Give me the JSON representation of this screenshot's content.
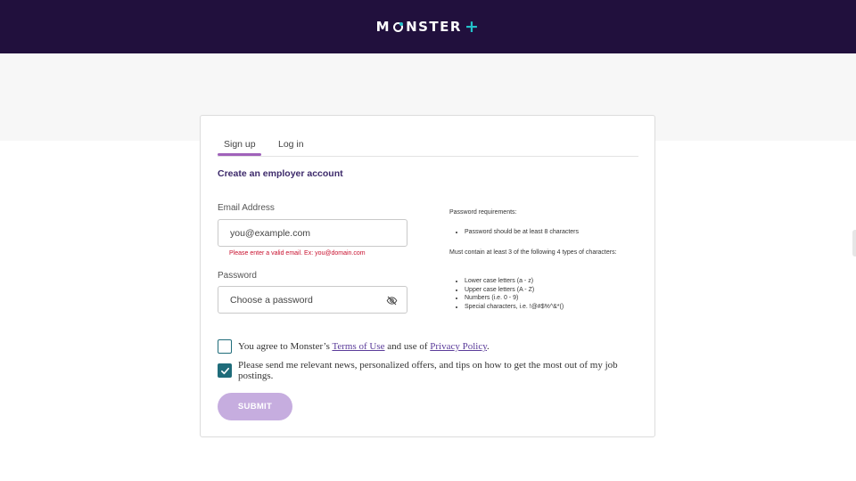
{
  "header": {
    "logo_text": "MONSTER",
    "logo_plus": "+",
    "logo_icon": "monster-logo-icon",
    "background_color": "#21103d",
    "accent_color": "#23c1c9"
  },
  "tabs": {
    "signup_label": "Sign up",
    "login_label": "Log in",
    "active": "Sign up",
    "active_underline_color": "#a062ba"
  },
  "form": {
    "heading": "Create an employer account",
    "email": {
      "label": "Email Address",
      "placeholder": "you@example.com",
      "value": "",
      "error": "Please enter a valid email. Ex: you@domain.com"
    },
    "password": {
      "label": "Password",
      "placeholder": "Choose a password",
      "value": "",
      "toggle_icon": "eye-slash-icon"
    },
    "requirements": {
      "title": "Password requirements:",
      "length_rule": "Password should be at least 8 characters",
      "intro": "Must contain at least 3 of the following 4 types of characters:",
      "types": [
        "Lower case letters (a - z)",
        "Upper case letters (A - Z)",
        "Numbers (i.e. 0 - 9)",
        "Special characters, i.e. !@#$%^&*()"
      ]
    },
    "terms": {
      "checked": false,
      "prefix": "You agree to Monster’s",
      "terms_link": "Terms of Use",
      "middle": "and use of",
      "privacy_link": "Privacy Policy",
      "suffix": "."
    },
    "news": {
      "checked": true,
      "label": "Please send me relevant news, personalized offers, and tips on how to get the most out of my job postings."
    },
    "submit_label": "SUBMIT",
    "submit_color": "#c6addf",
    "checkbox_color": "#1f6c7a"
  }
}
